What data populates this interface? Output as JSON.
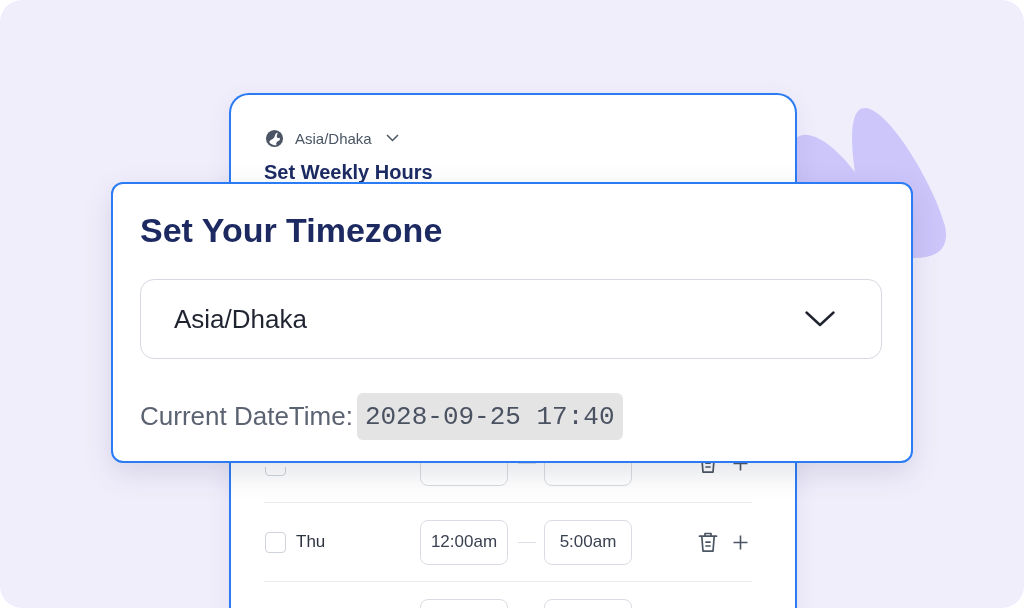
{
  "schedule_card": {
    "timezone": "Asia/Dhaka",
    "title": "Set Weekly Hours",
    "rows": [
      {
        "kind": "covered",
        "checked": false
      },
      {
        "kind": "day",
        "day": "Thu",
        "checked": false,
        "start": "12:00am",
        "end": "5:00am"
      },
      {
        "kind": "clipped"
      }
    ]
  },
  "timezone_card": {
    "title": "Set Your Timezone",
    "select": {
      "value": "Asia/Dhaka"
    },
    "datetime_label": "Current DateTime:",
    "datetime_value": "2028-09-25 17:40"
  }
}
